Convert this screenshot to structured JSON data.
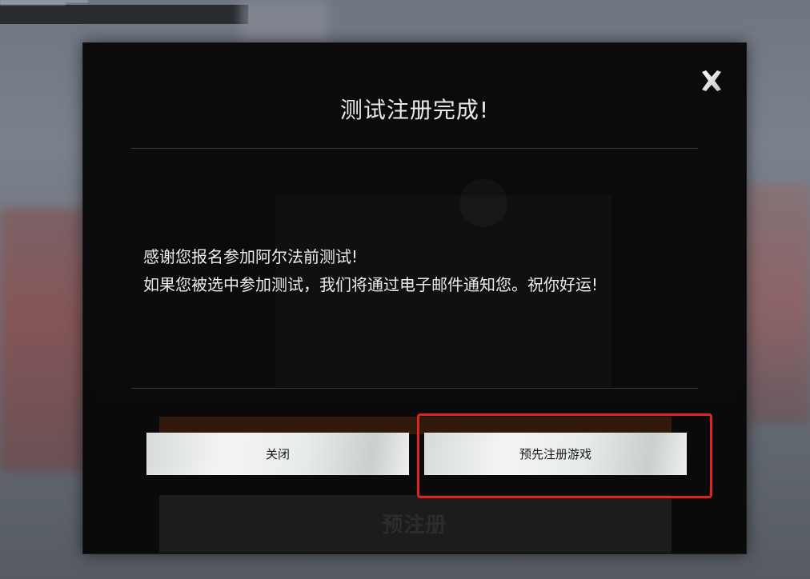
{
  "dialog": {
    "title": "测试注册完成!",
    "message_line1": "感谢您报名参加阿尔法前测试!",
    "message_line2": "如果您被选中参加测试，我们将通过电子邮件通知您。祝你好运!",
    "close_icon": "close-icon",
    "buttons": {
      "close_label": "关闭",
      "preregister_label": "预先注册游戏"
    }
  },
  "background": {
    "preregister_label": "预注册"
  },
  "colors": {
    "overlay": "#060607",
    "title_text": "#e9e9e9",
    "button_bg": "#e8ece9",
    "highlight_border": "#e0241c"
  }
}
